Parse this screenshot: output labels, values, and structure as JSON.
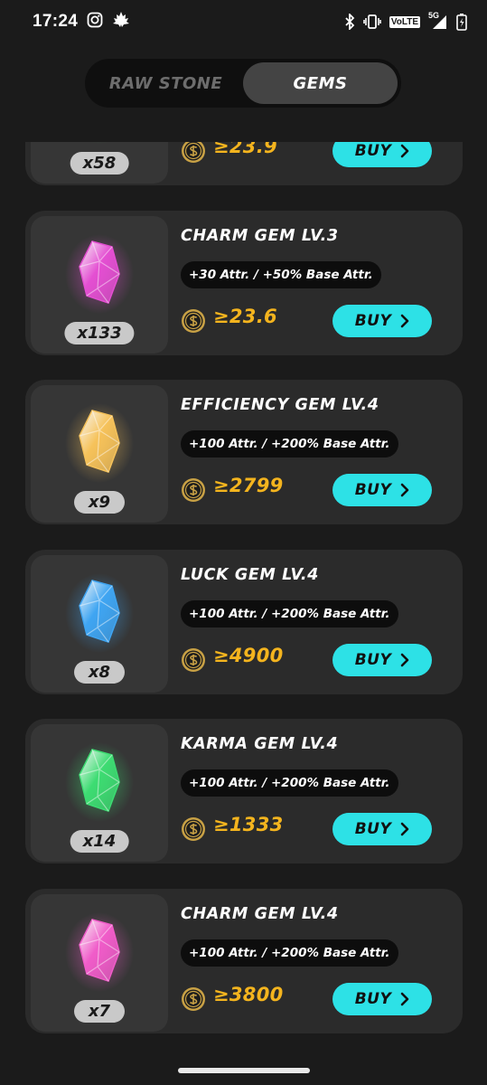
{
  "status_bar": {
    "time": "17:24",
    "network_badge": "VoLTE",
    "network_gen": "5G"
  },
  "tabs": [
    {
      "label": "RAW STONE",
      "active": false
    },
    {
      "label": "GEMS",
      "active": true
    }
  ],
  "gems": [
    {
      "title": "",
      "attr": "",
      "qty": "x58",
      "price": "≥23.9",
      "buy_label": "BUY",
      "color": "#33c95c"
    },
    {
      "title": "CHARM GEM LV.3",
      "attr": "+30 Attr. / +50% Base Attr.",
      "qty": "x133",
      "price": "≥23.6",
      "buy_label": "BUY",
      "color": "#e44fd2"
    },
    {
      "title": "EFFICIENCY GEM LV.4",
      "attr": "+100 Attr. / +200% Base Attr.",
      "qty": "x9",
      "price": "≥2799",
      "buy_label": "BUY",
      "color": "#f6c25a"
    },
    {
      "title": "LUCK GEM LV.4",
      "attr": "+100 Attr. / +200% Base Attr.",
      "qty": "x8",
      "price": "≥4900",
      "buy_label": "BUY",
      "color": "#3fa5f2"
    },
    {
      "title": "KARMA GEM LV.4",
      "attr": "+100 Attr. / +200% Base Attr.",
      "qty": "x14",
      "price": "≥1333",
      "buy_label": "BUY",
      "color": "#3ddc72"
    },
    {
      "title": "CHARM GEM LV.4",
      "attr": "+100 Attr. / +200% Base Attr.",
      "qty": "x7",
      "price": "≥3800",
      "buy_label": "BUY",
      "color": "#f05cc9"
    }
  ],
  "colors": {
    "accent_buy": "#2de1e6",
    "price": "#f4b41e",
    "card": "#2b2b2b",
    "background": "#1b1b1b"
  },
  "icons": {
    "coin": "coin-icon",
    "buy_arrow": "chevron-right-icon"
  }
}
